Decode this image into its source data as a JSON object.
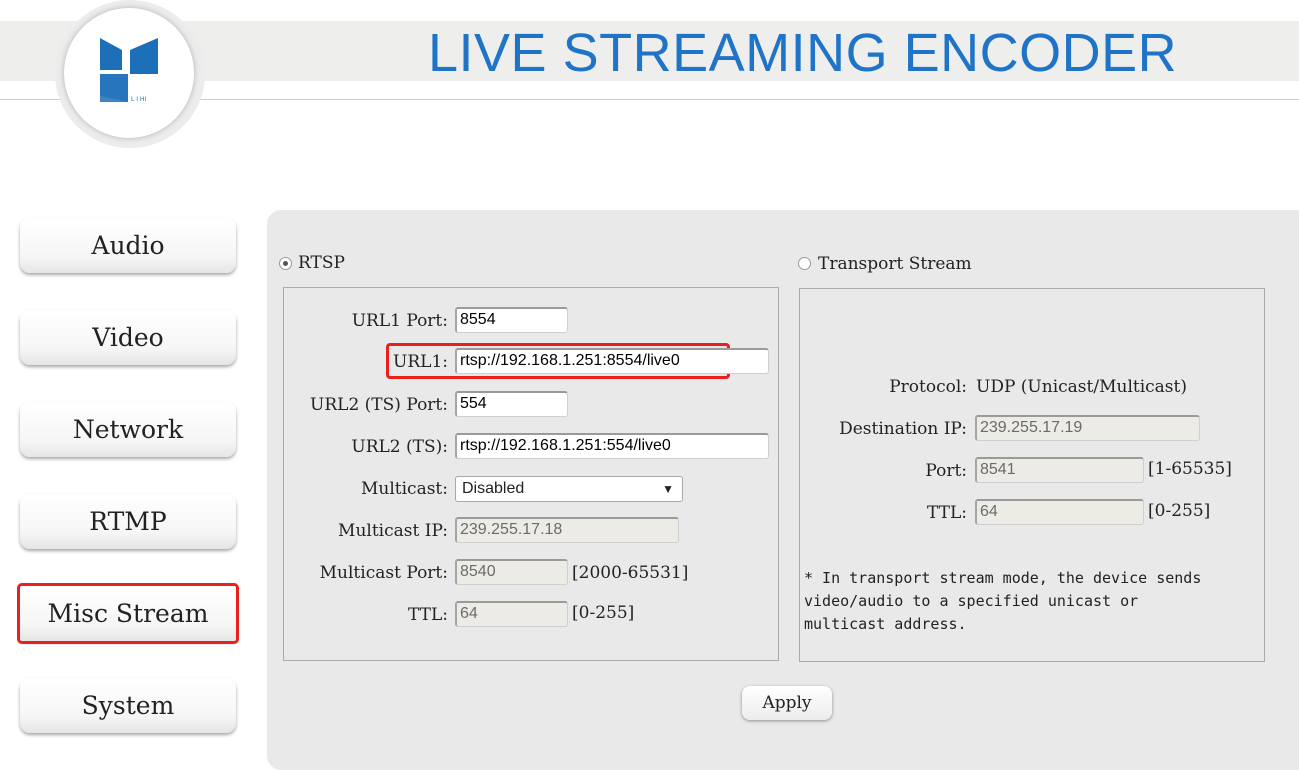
{
  "header": {
    "title": "LIVE STREAMING ENCODER",
    "logo_text": "L I HI"
  },
  "sidebar": {
    "items": [
      {
        "label": "Audio"
      },
      {
        "label": "Video"
      },
      {
        "label": "Network"
      },
      {
        "label": "RTMP"
      },
      {
        "label": "Misc Stream",
        "active": true
      },
      {
        "label": "System"
      }
    ]
  },
  "rtsp": {
    "radio_label": "RTSP",
    "selected": true,
    "url1_port_label": "URL1 Port:",
    "url1_port": "8554",
    "url1_label": "URL1:",
    "url1": "rtsp://192.168.1.251:8554/live0",
    "url2_port_label": "URL2 (TS) Port:",
    "url2_port": "554",
    "url2_label": "URL2 (TS):",
    "url2": "rtsp://192.168.1.251:554/live0",
    "multicast_label": "Multicast:",
    "multicast": "Disabled",
    "multicast_ip_label": "Multicast IP:",
    "multicast_ip": "239.255.17.18",
    "multicast_port_label": "Multicast Port:",
    "multicast_port": "8540",
    "multicast_port_range": "[2000-65531]",
    "ttl_label": "TTL:",
    "ttl": "64",
    "ttl_range": "[0-255]"
  },
  "ts": {
    "radio_label": "Transport Stream",
    "selected": false,
    "protocol_label": "Protocol:",
    "protocol": "UDP (Unicast/Multicast)",
    "dest_ip_label": "Destination IP:",
    "dest_ip": "239.255.17.19",
    "port_label": "Port:",
    "port": "8541",
    "port_range": "[1-65535]",
    "ttl_label": "TTL:",
    "ttl": "64",
    "ttl_range": "[0-255]",
    "note_line1": "* In transport stream mode, the device sends",
    "note_line2": "video/audio to a specified unicast or",
    "note_line3": "multicast address."
  },
  "apply_label": "Apply",
  "colors": {
    "title": "#1f74c8",
    "highlight": "#e8201e",
    "panel": "#e9e9e9"
  }
}
